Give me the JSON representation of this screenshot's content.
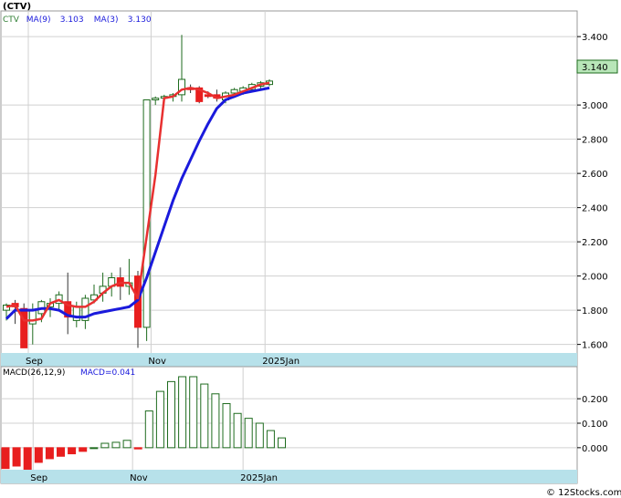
{
  "chart_data": {
    "type": "candlestick",
    "ticker_label": "(CTV)",
    "legend": [
      {
        "text": "CTV",
        "color": "#2e7d32"
      },
      {
        "text": "MA(9)",
        "color": "#1a1adc"
      },
      {
        "text": "3.103",
        "color": "#1a1adc"
      },
      {
        "text": "MA(3)",
        "color": "#1a1adc"
      },
      {
        "text": "3.130",
        "color": "#1a1adc"
      }
    ],
    "last_price": "3.140",
    "price_axis": {
      "ticks": [
        "3.400",
        "3.000",
        "2.800",
        "2.600",
        "2.400",
        "2.200",
        "2.000",
        "1.800",
        "1.600"
      ],
      "ylim": [
        1.55,
        3.55
      ]
    },
    "x_ticks": [
      {
        "label": "Sep",
        "index": 2.5
      },
      {
        "label": "Nov",
        "index": 16.5
      },
      {
        "label": "2025Jan",
        "index": 29.5
      }
    ],
    "candles": [
      {
        "o": 1.8,
        "h": 1.84,
        "l": 1.74,
        "c": 1.83
      },
      {
        "o": 1.84,
        "h": 1.86,
        "l": 1.72,
        "c": 1.82
      },
      {
        "o": 1.81,
        "h": 1.84,
        "l": 1.58,
        "c": 1.58
      },
      {
        "o": 1.72,
        "h": 1.84,
        "l": 1.6,
        "c": 1.8
      },
      {
        "o": 1.78,
        "h": 1.86,
        "l": 1.73,
        "c": 1.85
      },
      {
        "o": 1.82,
        "h": 1.87,
        "l": 1.76,
        "c": 1.84
      },
      {
        "o": 1.84,
        "h": 1.91,
        "l": 1.8,
        "c": 1.89
      },
      {
        "o": 1.85,
        "h": 2.02,
        "l": 1.66,
        "c": 1.76
      },
      {
        "o": 1.74,
        "h": 1.85,
        "l": 1.7,
        "c": 1.82
      },
      {
        "o": 1.74,
        "h": 1.89,
        "l": 1.69,
        "c": 1.87
      },
      {
        "o": 1.86,
        "h": 1.95,
        "l": 1.84,
        "c": 1.89
      },
      {
        "o": 1.9,
        "h": 2.02,
        "l": 1.85,
        "c": 1.94
      },
      {
        "o": 1.94,
        "h": 2.02,
        "l": 1.88,
        "c": 1.99
      },
      {
        "o": 1.99,
        "h": 2.05,
        "l": 1.86,
        "c": 1.94
      },
      {
        "o": 1.94,
        "h": 2.1,
        "l": 1.89,
        "c": 1.96
      },
      {
        "o": 2.0,
        "h": 2.03,
        "l": 1.58,
        "c": 1.7
      },
      {
        "o": 1.7,
        "h": 1.72,
        "l": 1.62,
        "c": 3.03
      },
      {
        "o": 3.03,
        "h": 3.05,
        "l": 3.0,
        "c": 3.04
      },
      {
        "o": 3.04,
        "h": 3.06,
        "l": 3.01,
        "c": 3.05
      },
      {
        "o": 3.05,
        "h": 3.07,
        "l": 3.02,
        "c": 3.06
      },
      {
        "o": 3.06,
        "h": 3.41,
        "l": 3.02,
        "c": 3.15
      },
      {
        "o": 3.1,
        "h": 3.12,
        "l": 3.07,
        "c": 3.09
      },
      {
        "o": 3.1,
        "h": 3.11,
        "l": 3.01,
        "c": 3.02
      },
      {
        "o": 3.06,
        "h": 3.08,
        "l": 3.04,
        "c": 3.05
      },
      {
        "o": 3.06,
        "h": 3.09,
        "l": 3.02,
        "c": 3.04
      },
      {
        "o": 3.03,
        "h": 3.08,
        "l": 3.01,
        "c": 3.07
      },
      {
        "o": 3.07,
        "h": 3.1,
        "l": 3.05,
        "c": 3.09
      },
      {
        "o": 3.08,
        "h": 3.11,
        "l": 3.06,
        "c": 3.1
      },
      {
        "o": 3.09,
        "h": 3.13,
        "l": 3.08,
        "c": 3.12
      },
      {
        "o": 3.11,
        "h": 3.14,
        "l": 3.09,
        "c": 3.13
      },
      {
        "o": 3.12,
        "h": 3.15,
        "l": 3.11,
        "c": 3.14
      }
    ],
    "ma_fast": [
      1.82,
      1.83,
      1.74,
      1.74,
      1.75,
      1.84,
      1.86,
      1.83,
      1.82,
      1.82,
      1.85,
      1.9,
      1.94,
      1.96,
      1.96,
      1.87,
      2.23,
      2.59,
      3.04,
      3.05,
      3.09,
      3.1,
      3.09,
      3.07,
      3.04,
      3.05,
      3.06,
      3.08,
      3.1,
      3.12,
      3.13
    ],
    "ma_slow": [
      1.75,
      1.8,
      1.8,
      1.8,
      1.81,
      1.81,
      1.8,
      1.77,
      1.76,
      1.76,
      1.78,
      1.79,
      1.8,
      1.81,
      1.82,
      1.86,
      1.99,
      2.14,
      2.29,
      2.44,
      2.57,
      2.68,
      2.79,
      2.89,
      2.98,
      3.03,
      3.05,
      3.07,
      3.08,
      3.09,
      3.1
    ],
    "macd_panel": {
      "title": "MACD(26,12,9)",
      "value_label": "MACD=0.041",
      "ticks": [
        "0.200",
        "0.100",
        "0.000"
      ],
      "ylim": [
        -0.09,
        0.29
      ],
      "x_ticks": [
        {
          "label": "Sep",
          "index": 2.5
        },
        {
          "label": "Nov",
          "index": 11.5
        },
        {
          "label": "2025Jan",
          "index": 21.5
        }
      ],
      "bars": [
        -0.085,
        -0.075,
        -0.09,
        -0.06,
        -0.045,
        -0.035,
        -0.025,
        -0.015,
        0.0,
        0.018,
        0.022,
        0.03,
        -0.005,
        0.15,
        0.23,
        0.27,
        0.29,
        0.29,
        0.26,
        0.22,
        0.18,
        0.14,
        0.12,
        0.1,
        0.07,
        0.04
      ]
    }
  },
  "watermark": "© 12Stocks.com",
  "colors": {
    "bull": "#1e6b1e",
    "bear": "#e81e1e",
    "ma_slow": "#1a1adc",
    "ma_fast": "#e83030",
    "axis_band": "#b7e1ea",
    "grid": "#d0d0d0",
    "last_price_box": "#b8e6b8"
  }
}
